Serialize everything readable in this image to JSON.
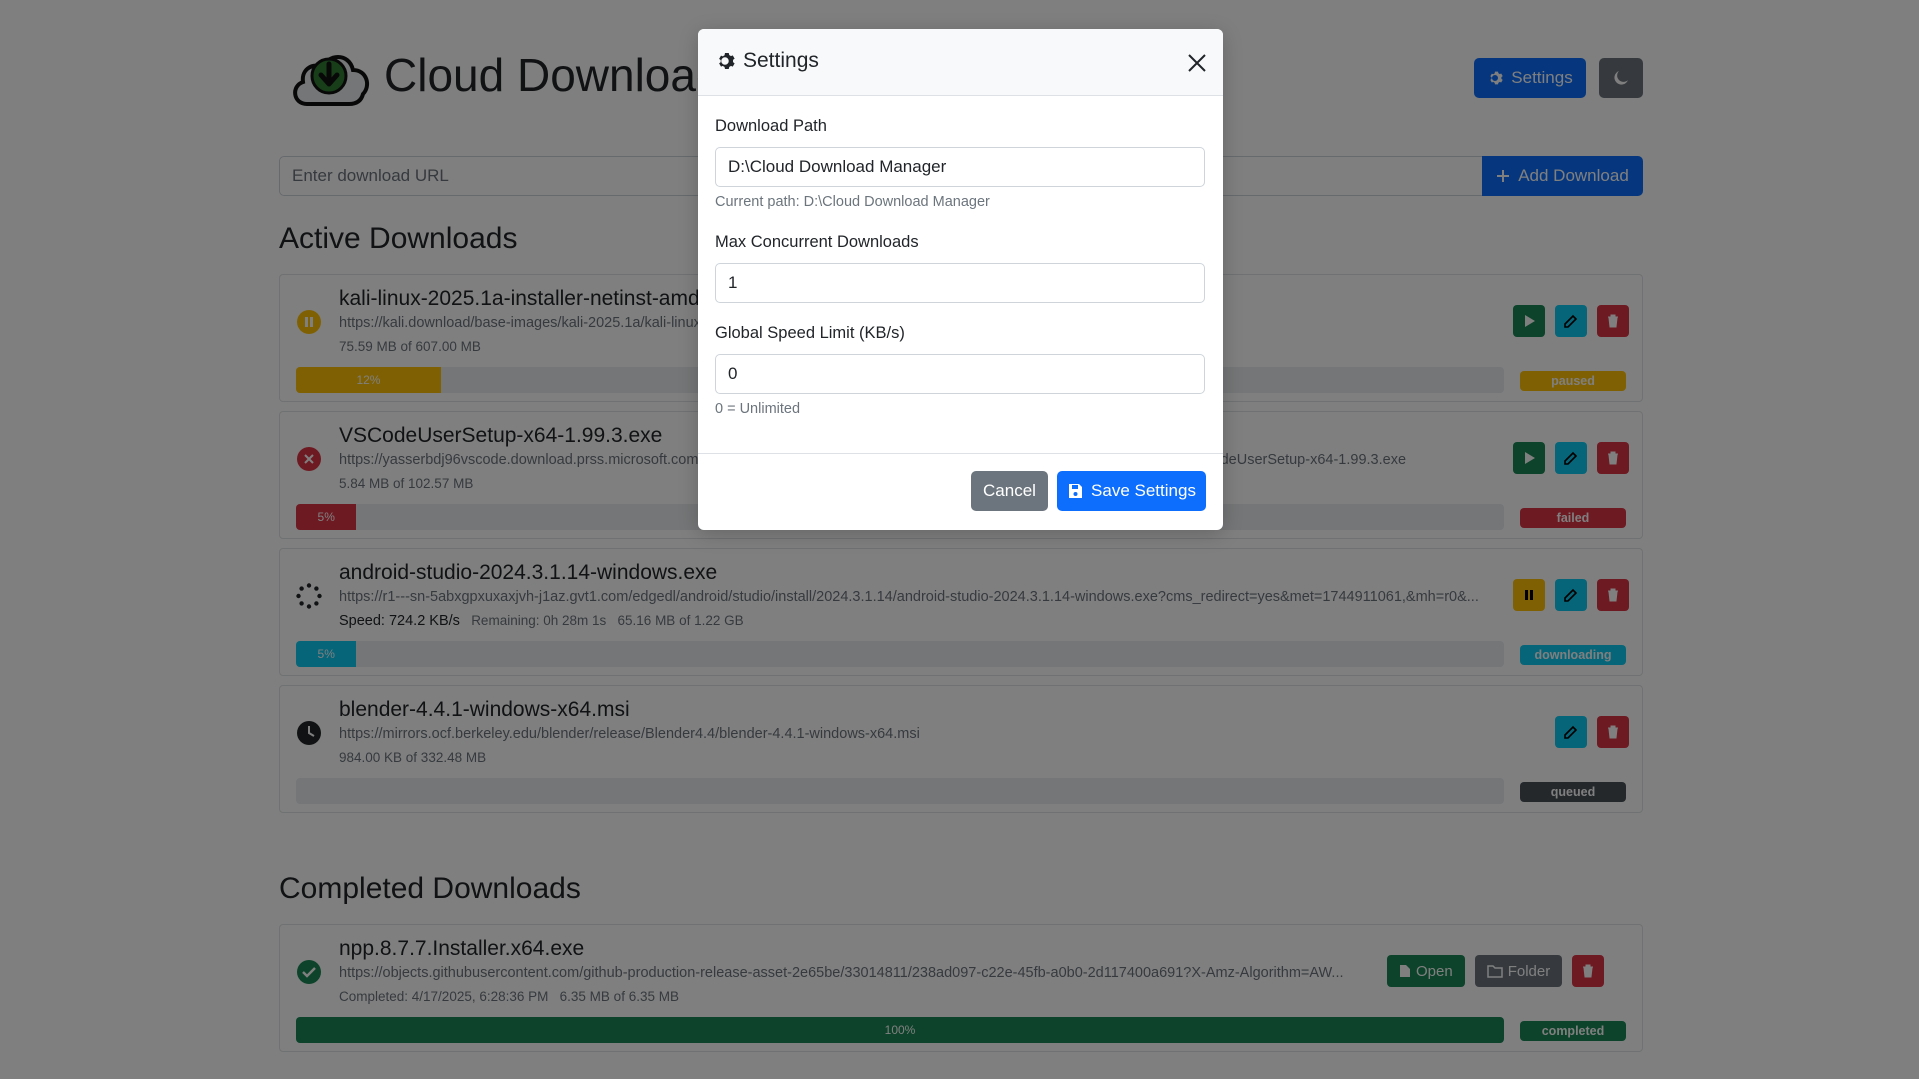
{
  "app": {
    "title": "Cloud Download Manager",
    "settings_label": "Settings",
    "url_placeholder": "Enter download URL",
    "add_label": "Add Download"
  },
  "active": {
    "title": "Active Downloads",
    "items": [
      {
        "name": "kali-linux-2025.1a-installer-netinst-amd64.iso",
        "url": "https://kali.download/base-images/kali-2025.1a/kali-linux-2025.1a-installer-netinst-amd64.iso",
        "meta": "75.59 MB of 607.00 MB",
        "progress": 12,
        "progress_label": "12%",
        "status": "paused"
      },
      {
        "name": "VSCodeUserSetup-x64-1.99.3.exe",
        "url": "https://yasserbdj96vscode.download.prss.microsoft.com/dbazure/download/stable/17baf841131aa23349f217ca7c570c76ee87b957/VSCodeUserSetup-x64-1.99.3.exe",
        "meta": "5.84 MB of 102.57 MB",
        "progress": 5,
        "progress_label": "5%",
        "status": "failed"
      },
      {
        "name": "android-studio-2024.3.1.14-windows.exe",
        "url": "https://r1---sn-5abxgpxuxaxjvh-j1az.gvt1.com/edgedl/android/studio/install/2024.3.1.14/android-studio-2024.3.1.14-windows.exe?cms_redirect=yes&met=1744911061,&mh=r0&...",
        "speed": "Speed: 724.2 KB/s",
        "remaining": "Remaining: 0h 28m 1s",
        "meta": "65.16 MB of 1.22 GB",
        "progress": 5,
        "progress_label": "5%",
        "status": "downloading"
      },
      {
        "name": "blender-4.4.1-windows-x64.msi",
        "url": "https://mirrors.ocf.berkeley.edu/blender/release/Blender4.4/blender-4.4.1-windows-x64.msi",
        "meta": "984.00 KB of 332.48 MB",
        "progress": 0,
        "progress_label": "",
        "status": "queued"
      }
    ]
  },
  "completed": {
    "title": "Completed Downloads",
    "items": [
      {
        "name": "npp.8.7.7.Installer.x64.exe",
        "url": "https://objects.githubusercontent.com/github-production-release-asset-2e65be/33014811/238ad097-c22e-45fb-a0b0-2d117400a691?X-Amz-Algorithm=AW...",
        "completed": "Completed: 4/17/2025, 6:28:36 PM",
        "meta": "6.35 MB of 6.35 MB",
        "progress": 100,
        "progress_label": "100%",
        "status": "completed",
        "open_label": "Open",
        "folder_label": "Folder"
      }
    ]
  },
  "modal": {
    "title": "Settings",
    "download_path_label": "Download Path",
    "download_path_value": "D:\\Cloud Download Manager",
    "current_path": "Current path: D:\\Cloud Download Manager",
    "max_concurrent_label": "Max Concurrent Downloads",
    "max_concurrent_value": "1",
    "speed_limit_label": "Global Speed Limit (KB/s)",
    "speed_limit_value": "0",
    "speed_limit_help": "0 = Unlimited",
    "cancel_label": "Cancel",
    "save_label": "Save Settings"
  },
  "colors": {
    "primary": "#0d6efd",
    "paused": "#ffc107",
    "failed": "#dc3545",
    "downloading": "#0dcaf0",
    "queued": "#495057",
    "completed": "#198754"
  },
  "icons": {
    "logo": "cloud-download-icon",
    "settings": "gear-icon",
    "theme": "moon-icon",
    "add": "plus-icon",
    "paused": "pause-circle-icon",
    "failed": "x-circle-icon",
    "downloading": "spinner-icon",
    "queued": "clock-icon",
    "completed": "check-circle-icon",
    "resume": "play-icon",
    "pause": "pause-icon",
    "edit": "edit-icon",
    "delete": "trash-icon",
    "open": "file-icon",
    "folder": "folder-icon",
    "close": "close-icon",
    "save": "floppy-icon"
  }
}
